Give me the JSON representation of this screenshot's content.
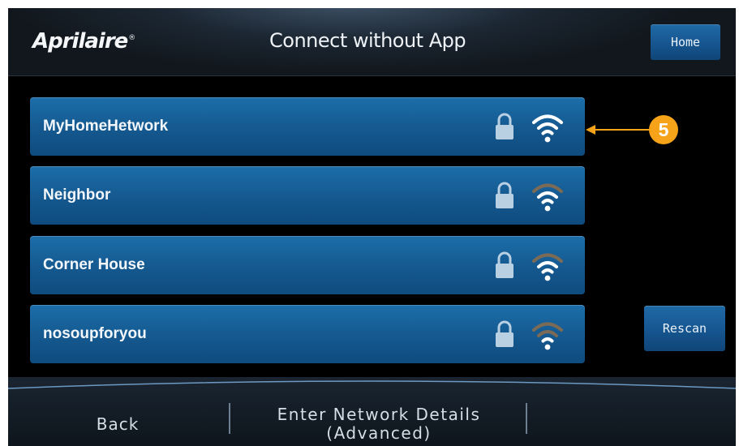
{
  "header": {
    "brand": "Aprilaire",
    "brand_mark": "®",
    "title": "Connect without App",
    "home_label": "Home"
  },
  "networks": [
    {
      "name": "MyHomeHetwork",
      "locked": true,
      "signal": "strong"
    },
    {
      "name": "Neighbor",
      "locked": true,
      "signal": "medium"
    },
    {
      "name": "Corner House",
      "locked": true,
      "signal": "medium"
    },
    {
      "name": "nosoupforyou",
      "locked": true,
      "signal": "weak"
    }
  ],
  "rescan_label": "Rescan",
  "annotation": {
    "number": "5"
  },
  "footer": {
    "back_label": "Back",
    "advanced_line1": "Enter Network Details",
    "advanced_line2": "(Advanced)"
  },
  "colors": {
    "button_blue": "#165590",
    "callout_orange": "#f6a31a",
    "wifi_active": "#ffffff",
    "wifi_dim": "#7b6a55",
    "lock": "#b9cfe2"
  },
  "icons": {
    "lock": "lock-icon",
    "wifi": "wifi-icon"
  }
}
